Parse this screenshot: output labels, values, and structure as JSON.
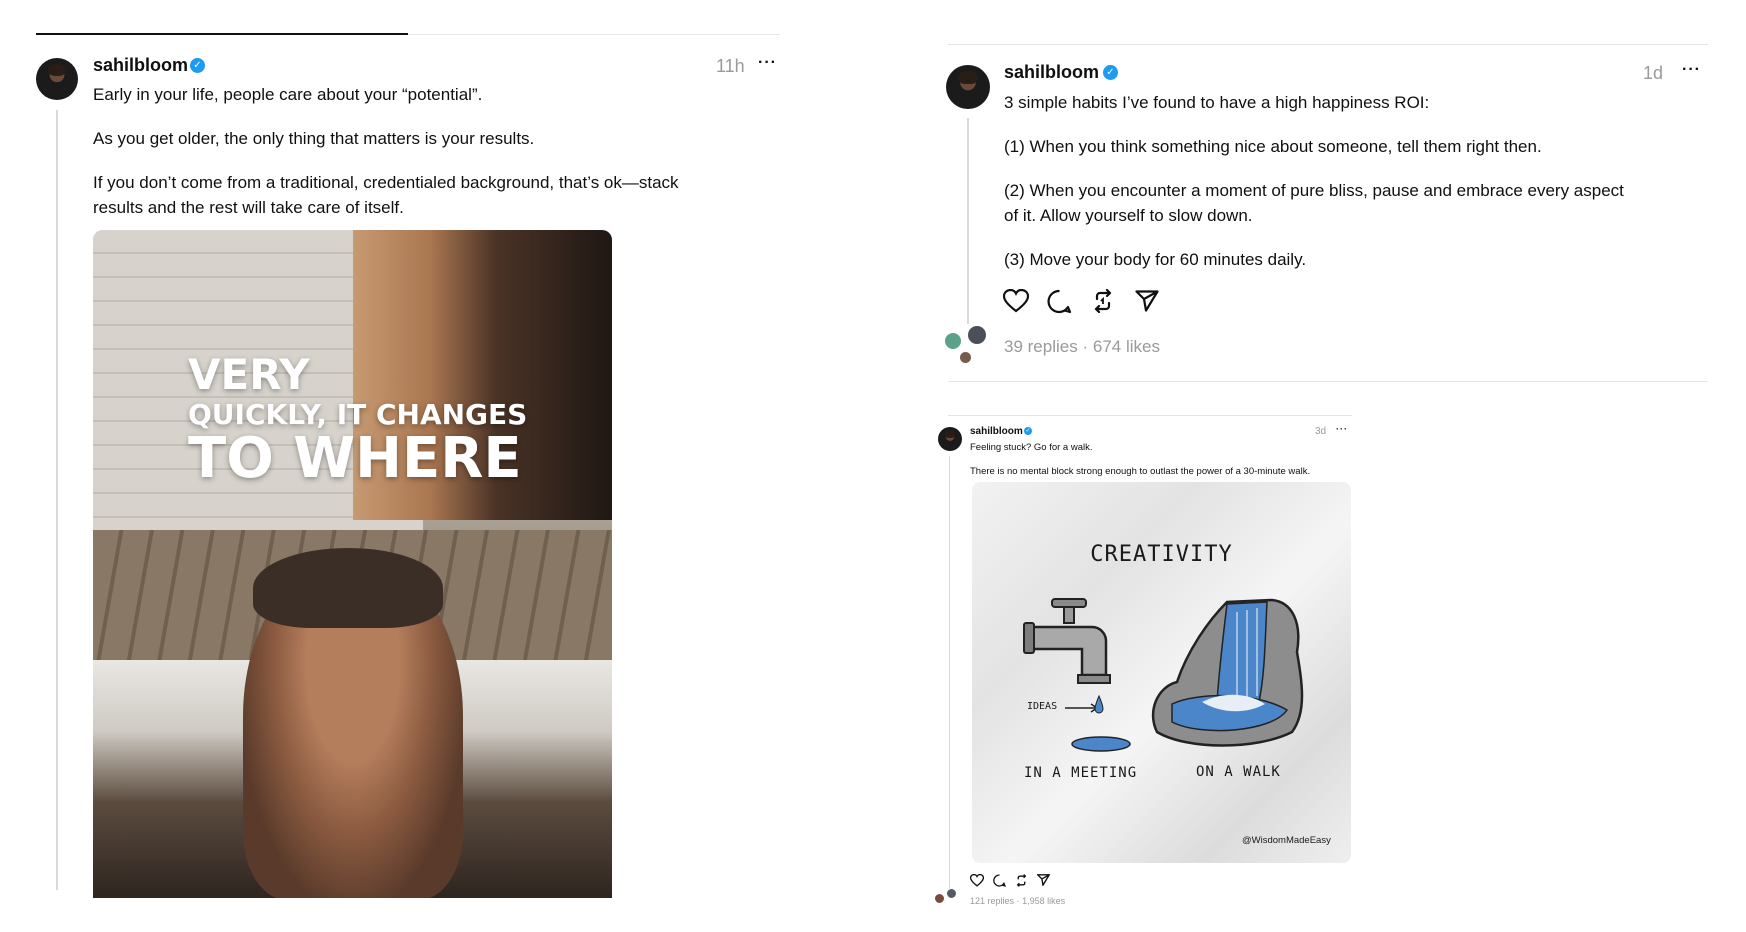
{
  "left_post": {
    "username": "sahilbloom",
    "time": "11h",
    "more": "···",
    "paragraphs": [
      "Early in your life, people care about your “potential”.",
      "As you get older, the only thing that matters is your results.",
      "If you don’t come from a traditional, credentialed background, that’s ok—stack",
      "results and the rest will take care of itself."
    ],
    "video_overlay": [
      "VERY",
      "QUICKLY, IT CHANGES",
      "TO WHERE"
    ]
  },
  "right_post": {
    "username": "sahilbloom",
    "time": "1d",
    "more": "···",
    "paragraphs": [
      "3 simple habits I’ve found to have a high happiness ROI:",
      "(1) When you think something nice about someone, tell them right then.",
      "(2) When you encounter a moment of pure bliss, pause and embrace every aspect",
      "of it. Allow yourself to slow down.",
      "(3) Move your body for 60 minutes daily."
    ],
    "replies": "39 replies",
    "separator": "·",
    "likes": "674 likes"
  },
  "small_post": {
    "username": "sahilbloom",
    "time": "3d",
    "more": "···",
    "line1": "Feeling stuck? Go for a walk.",
    "line2": "There is no mental block strong enough to outlast the power of a 30-minute walk.",
    "card": {
      "title": "CREATIVITY",
      "ideas_label": "IDEAS",
      "meeting_label": "IN A MEETING",
      "walk_label": "ON A WALK",
      "credit": "@WisdomMadeEasy"
    },
    "replies": "121 replies",
    "separator": "·",
    "likes": "1,958 likes"
  },
  "colors": {
    "verified": "#1d9bf0",
    "muted": "#9a9a9a",
    "water": "#4a86c9"
  },
  "icons": [
    "heart-icon",
    "comment-icon",
    "repost-icon",
    "share-icon",
    "verified-icon",
    "more-icon"
  ]
}
